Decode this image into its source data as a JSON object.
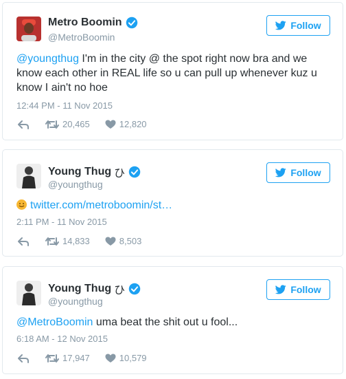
{
  "tweets": [
    {
      "display_name": "Metro Boomin",
      "handle": "@MetroBoomin",
      "follow_label": "Follow",
      "mention": "@youngthug",
      "text": " I'm in the city @ the spot right now bra and we know each other in REAL life so u can pull up whenever kuz u know I ain't no hoe",
      "timestamp": "12:44 PM - 11 Nov 2015",
      "retweets": "20,465",
      "likes": "12,820"
    },
    {
      "display_name": "Young Thug",
      "name_glyph": "ひ",
      "handle": "@youngthug",
      "follow_label": "Follow",
      "link": "twitter.com/metroboomin/st…",
      "timestamp": "2:11 PM - 11 Nov 2015",
      "retweets": "14,833",
      "likes": "8,503"
    },
    {
      "display_name": "Young Thug",
      "name_glyph": "ひ",
      "handle": "@youngthug",
      "follow_label": "Follow",
      "mention": "@MetroBoomin",
      "text": " uma beat the shit out u fool...",
      "timestamp": "6:18 AM - 12 Nov 2015",
      "retweets": "17,947",
      "likes": "10,579"
    }
  ],
  "colors": {
    "accent": "#1da1f2",
    "muted": "#8899a6",
    "text": "#292f33",
    "border": "#e1e8ed"
  },
  "icons": [
    "avatar",
    "verified-icon",
    "twitter-bird-icon",
    "reply-icon",
    "retweet-icon",
    "heart-icon",
    "smile-emoji-icon"
  ]
}
